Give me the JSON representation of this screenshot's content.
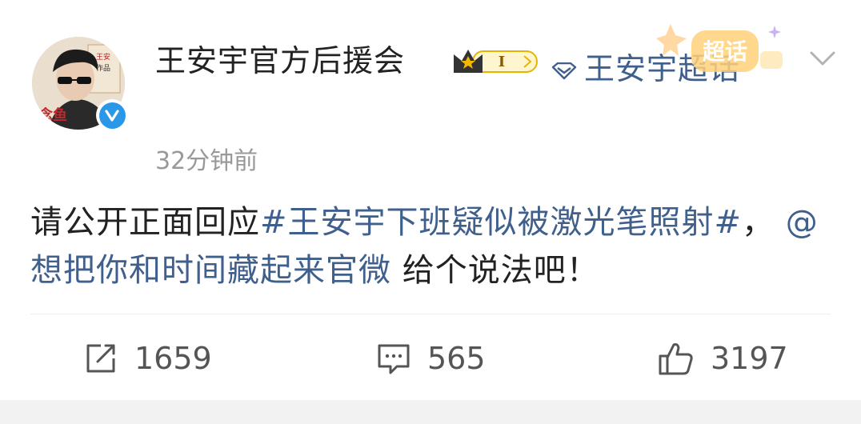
{
  "post": {
    "username": "王安宇官方后援会",
    "super_topic_label": "王安宇超话",
    "super_sticker_text": "超话",
    "fan_level": "I",
    "timestamp": "32分钟前",
    "text_prefix": "请公开正面回应",
    "topic": "#王安宇下班疑似被激光笔照射#",
    "text_middle": "， ",
    "mention": "@想把你和时间藏起来官微",
    "text_suffix": " 给个说法吧！"
  },
  "actions": {
    "repost_count": "1659",
    "comment_count": "565",
    "like_count": "3197"
  },
  "colors": {
    "link": "#3f5f8c",
    "text": "#222222",
    "muted": "#999999",
    "verified": "#2a97e8",
    "badge_gold": "#f5b800"
  },
  "icons": {
    "verified": "verified-v-icon",
    "crown": "crown-icon",
    "diamond": "diamond-icon",
    "chevron": "chevron-down-icon",
    "repost": "repost-icon",
    "comment": "comment-icon",
    "like": "thumbs-up-icon"
  }
}
